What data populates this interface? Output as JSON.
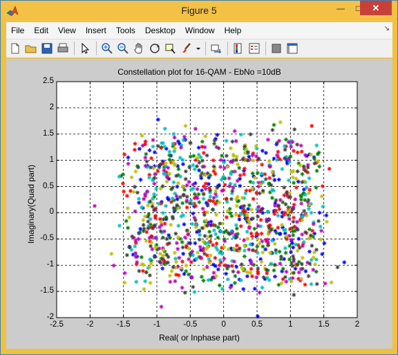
{
  "window": {
    "title": "Figure 5",
    "close_label": "✕",
    "minimize_label": "—",
    "maximize_label": "□"
  },
  "menu": {
    "items": [
      "File",
      "Edit",
      "View",
      "Insert",
      "Tools",
      "Desktop",
      "Window",
      "Help"
    ],
    "dock_glyph": "↘"
  },
  "toolbar": {
    "buttons": [
      "new-figure-icon",
      "open-file-icon",
      "save-icon",
      "print-icon",
      "pointer-icon",
      "zoom-in-icon",
      "zoom-out-icon",
      "pan-icon",
      "rotate-3d-icon",
      "data-cursor-icon",
      "brush-icon",
      "link-plot-icon",
      "colorbar-icon",
      "legend-icon",
      "hide-plot-tools-icon",
      "show-plot-tools-icon"
    ]
  },
  "chart_data": {
    "type": "scatter",
    "title": "Constellation plot for 16-QAM - EbNo =10dB",
    "xlabel": "Real( or Inphase part)",
    "ylabel": "Imaginary(Quad part)",
    "xlim": [
      -2.5,
      2
    ],
    "ylim": [
      -2,
      2.5
    ],
    "xticks": [
      "-2.5",
      "-2",
      "-1.5",
      "-1",
      "-0.5",
      "0",
      "0.5",
      "1",
      "1.5",
      "2"
    ],
    "yticks": [
      "2.5",
      "2",
      "1.5",
      "1",
      "0.5",
      "0",
      "-0.5",
      "-1",
      "-1.5",
      "-2"
    ],
    "grid": true,
    "marker": "*",
    "colors": [
      "#0000ff",
      "#008000",
      "#ff0000",
      "#00bfbf",
      "#bf00bf",
      "#bfbf00",
      "#404040"
    ],
    "cluster_centers_x": [
      -1,
      -0.35,
      0.35,
      1
    ],
    "cluster_centers_y": [
      -1,
      -0.35,
      0.35,
      1
    ],
    "noise_std": 0.28,
    "points_per_color": 160
  }
}
